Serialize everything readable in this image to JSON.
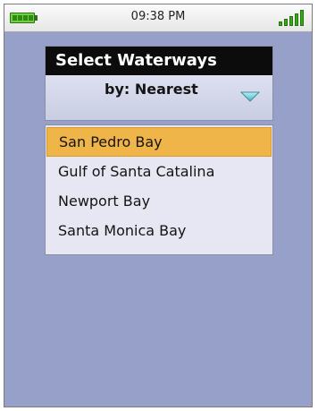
{
  "status_bar": {
    "time": "09:38 PM",
    "battery_icon": "battery-full-icon",
    "signal_icon": "signal-strength-icon",
    "accent_color": "#37a81a"
  },
  "header": {
    "title": "Select Waterways",
    "sort_label": "by: Nearest",
    "sort_icon": "chevron-down-icon"
  },
  "list": {
    "selected_index": 0,
    "selected_color": "#f0b548",
    "items": [
      {
        "label": "San Pedro Bay"
      },
      {
        "label": "Gulf of Santa Catalina"
      },
      {
        "label": "Newport Bay"
      },
      {
        "label": "Santa Monica Bay"
      }
    ]
  }
}
